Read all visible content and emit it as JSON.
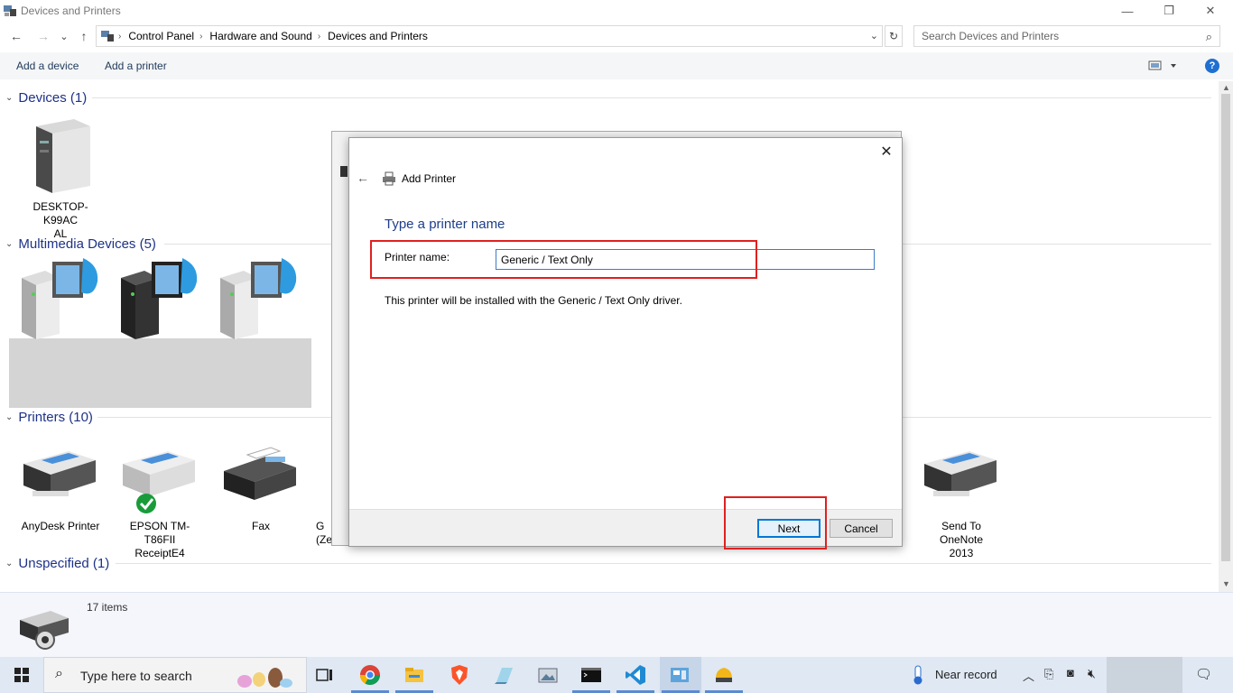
{
  "window": {
    "title": "Devices and Printers",
    "minimize_glyph": "—",
    "restore_glyph": "❐",
    "close_glyph": "✕"
  },
  "nav": {
    "back_glyph": "←",
    "forward_glyph": "→",
    "recent_glyph": "⌄",
    "up_glyph": "↑",
    "breadcrumb": [
      "Control Panel",
      "Hardware and Sound",
      "Devices and Printers"
    ],
    "separator": "›",
    "search_placeholder": "Search Devices and Printers"
  },
  "commands": {
    "add_device": "Add a device",
    "add_printer": "Add a printer",
    "help": "?"
  },
  "groups": {
    "devices": {
      "label": "Devices (1)",
      "items": [
        "DESKTOP-K99ACAL"
      ]
    },
    "multimedia": {
      "label": "Multimedia Devices (5)"
    },
    "printers": {
      "label": "Printers (10)",
      "items": [
        "AnyDesk Printer",
        "EPSON TM-T86FII ReceiptE4",
        "Fax",
        "G",
        "(Zebr",
        "Send To OneNote 2013"
      ]
    },
    "unspecified": {
      "label": "Unspecified (1)"
    }
  },
  "details": {
    "count": "17 items"
  },
  "taskbar": {
    "search_text": "Type here to search",
    "weather": "Near record"
  },
  "dialog": {
    "title": "Add Printer",
    "close_glyph": "✕",
    "back_glyph": "←",
    "heading": "Type a printer name",
    "printer_name_label": "Printer name:",
    "printer_name_value": "Generic / Text Only",
    "description": "This printer will be installed with the Generic / Text Only driver.",
    "next_label": "Next",
    "cancel_label": "Cancel"
  },
  "colors": {
    "accent": "#0078d7",
    "heading": "#1e3e8a",
    "highlight_box": "#e02020"
  }
}
